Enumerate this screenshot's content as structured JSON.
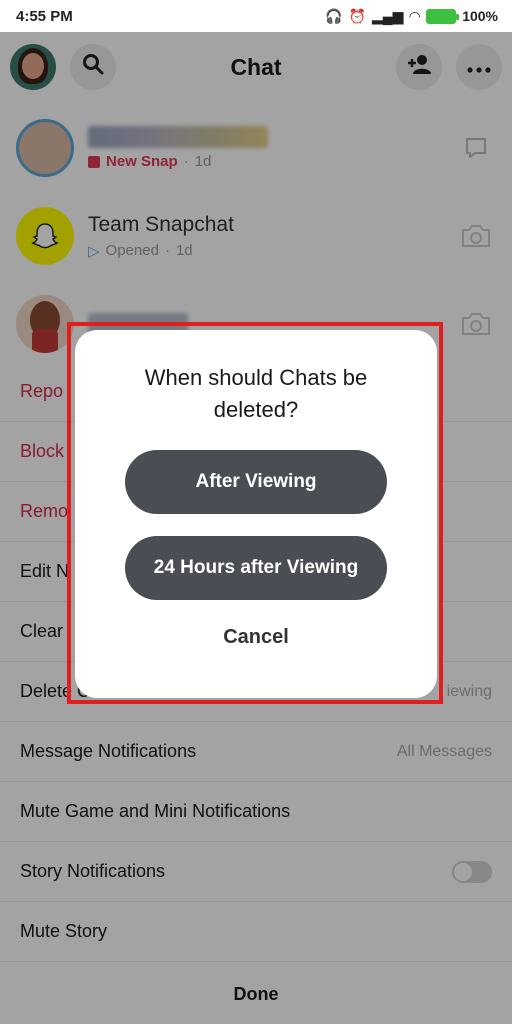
{
  "status_bar": {
    "time": "4:55 PM",
    "battery": "100%"
  },
  "header": {
    "title": "Chat"
  },
  "chats": [
    {
      "name": "",
      "status": "New Snap",
      "age": "1d"
    },
    {
      "name": "Team Snapchat",
      "status": "Opened",
      "age": "1d"
    },
    {
      "name": "",
      "status": "",
      "age": ""
    }
  ],
  "sheet": {
    "items": [
      {
        "label": "Repo",
        "value": ""
      },
      {
        "label": "Block",
        "value": ""
      },
      {
        "label": "Remo",
        "value": ""
      },
      {
        "label": "Edit N",
        "value": ""
      },
      {
        "label": "Clear",
        "value": ""
      },
      {
        "label": "Delete Chats...",
        "value": "iewing"
      },
      {
        "label": "Message Notifications",
        "value": "All Messages"
      },
      {
        "label": "Mute Game and Mini Notifications",
        "value": ""
      },
      {
        "label": "Story Notifications",
        "value": ""
      },
      {
        "label": "Mute Story",
        "value": ""
      }
    ],
    "done_label": "Done"
  },
  "dialog": {
    "title": "When should Chats be deleted?",
    "option1": "After Viewing",
    "option2": "24 Hours after Viewing",
    "cancel": "Cancel"
  },
  "colors": {
    "accent": "#fffc00",
    "danger": "#d5294f",
    "highlight": "#e0201e",
    "button": "#4a4d54"
  }
}
